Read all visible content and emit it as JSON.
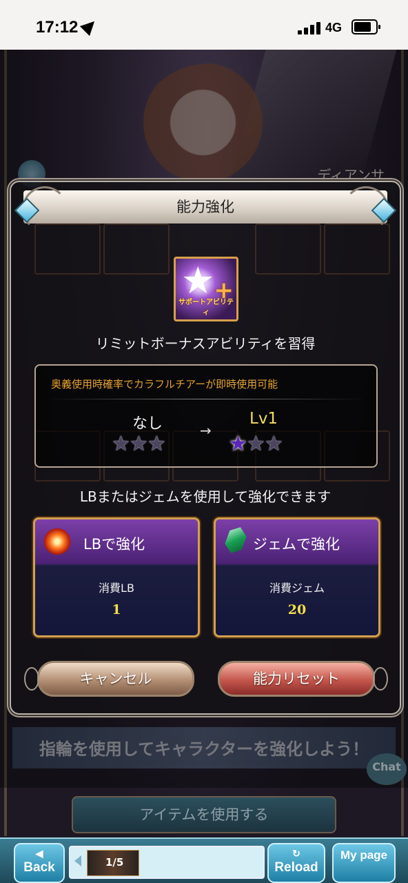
{
  "status_bar": {
    "time": "17:12",
    "network": "4G"
  },
  "background": {
    "character_name": "ディアンサ",
    "banner_text": "指輪を使用してキャラクターを強化しよう！",
    "chat_label": "Chat",
    "item_button_label": "アイテムを使用する"
  },
  "dialog": {
    "title": "能力強化",
    "ability_icon_caption": "サポートアビリティ",
    "ability_name": "リミットボーナスアビリティを習得",
    "description": "奥義使用時確率でカラフルチアーが即時使用可能",
    "level_before": "なし",
    "level_after": "Lv1",
    "arrow": "→",
    "stars_before": [
      "empty",
      "empty",
      "empty"
    ],
    "stars_after": [
      "filled",
      "empty",
      "empty"
    ],
    "hint": "LBまたはジェムを使用して強化できます",
    "lb_option": {
      "title": "LBで強化",
      "cost_label": "消費LB",
      "cost_value": "1"
    },
    "gem_option": {
      "title": "ジェムで強化",
      "cost_label": "消費ジェム",
      "cost_value": "20"
    },
    "cancel_label": "キャンセル",
    "reset_label": "能力リセット"
  },
  "bottom_nav": {
    "back_label": "Back",
    "reload_label": "Reload",
    "mypage_label": "My page",
    "thumbnail_text": "1/5"
  }
}
